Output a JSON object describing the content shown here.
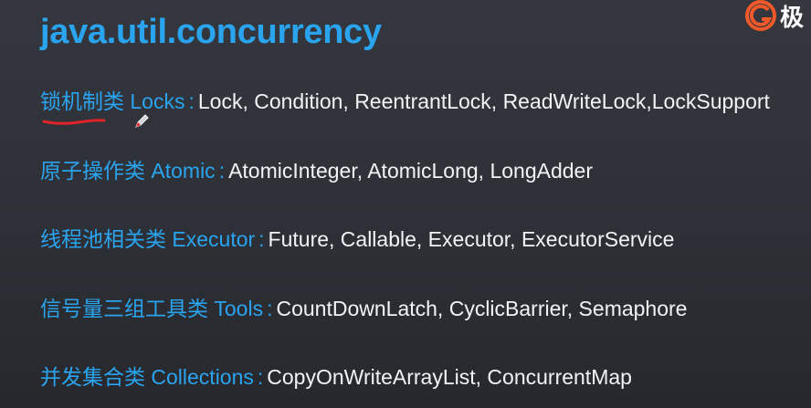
{
  "title": "java.util.concurrency",
  "logo": {
    "text": "极",
    "mark": "G"
  },
  "rows": [
    {
      "category": "锁机制类 Locks",
      "separator": ":",
      "items": "Lock, Condition, ReentrantLock, ReadWriteLock,LockSupport"
    },
    {
      "category": "原子操作类 Atomic",
      "separator": ":",
      "items": "AtomicInteger, AtomicLong, LongAdder"
    },
    {
      "category": "线程池相关类 Executor",
      "separator": ":",
      "items": "Future, Callable, Executor, ExecutorService"
    },
    {
      "category": "信号量三组工具类 Tools",
      "separator": ":",
      "items": "CountDownLatch, CyclicBarrier, Semaphore"
    },
    {
      "category": "并发集合类 Collections",
      "separator": ":",
      "items": "CopyOnWriteArrayList, ConcurrentMap"
    }
  ],
  "colors": {
    "accent": "#2aa4ef",
    "text": "#f2f3f5",
    "annotation": "#e0242a",
    "logo": "#f2592a"
  }
}
